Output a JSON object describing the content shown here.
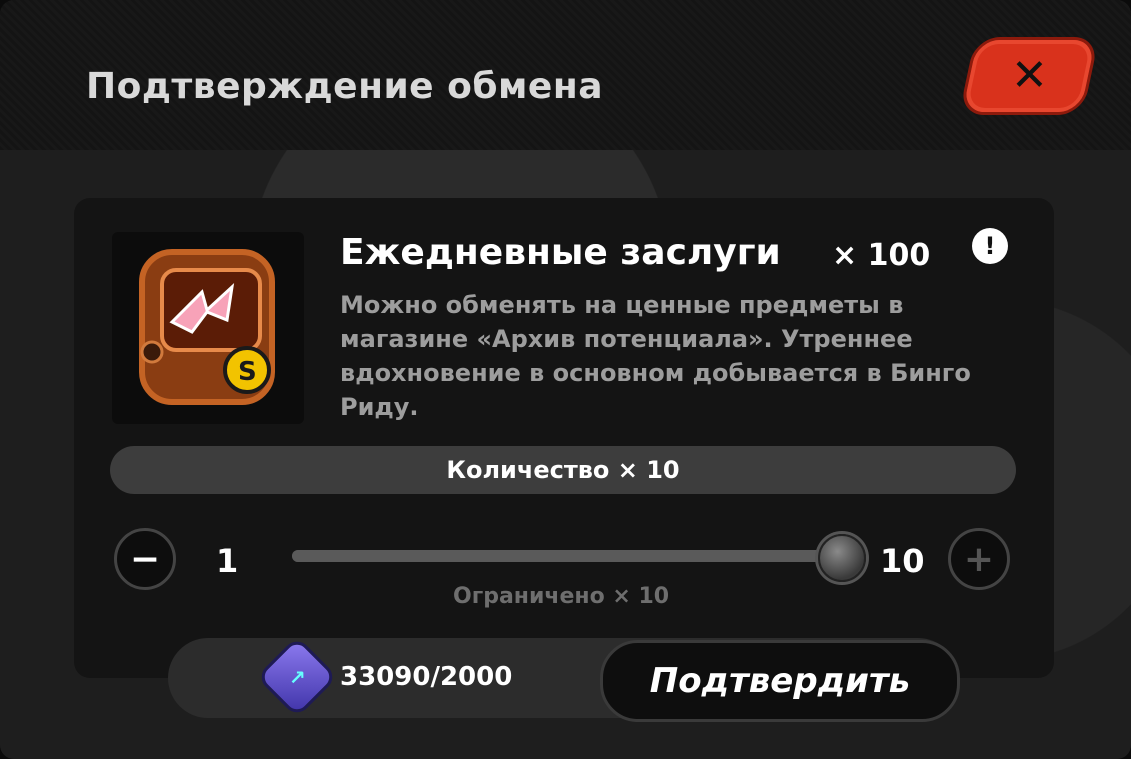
{
  "dialog": {
    "title": "Подтверждение обмена",
    "close_icon": "close-icon"
  },
  "item": {
    "name": "Ежедневные заслуги",
    "count": "× 100",
    "description": "Можно обменять на ценные предметы в магазине «Архив потенциала». Утреннее вдохновение в основном добывается в Бинго Риду.",
    "icon": "daily-merit-device-icon",
    "info_icon": "info-icon",
    "badge": "S"
  },
  "quantity": {
    "label": "Количество × 10",
    "min": "1",
    "max": "10",
    "fill_fraction": 1.0,
    "limit": "Ограничено × 10"
  },
  "cost": {
    "icon": "currency-icon",
    "value": "33090/2000"
  },
  "confirm": {
    "label": "Подтвердить"
  },
  "colors": {
    "close": "#d9321c",
    "panel": "#141414",
    "bar": "#3d3d3d"
  }
}
